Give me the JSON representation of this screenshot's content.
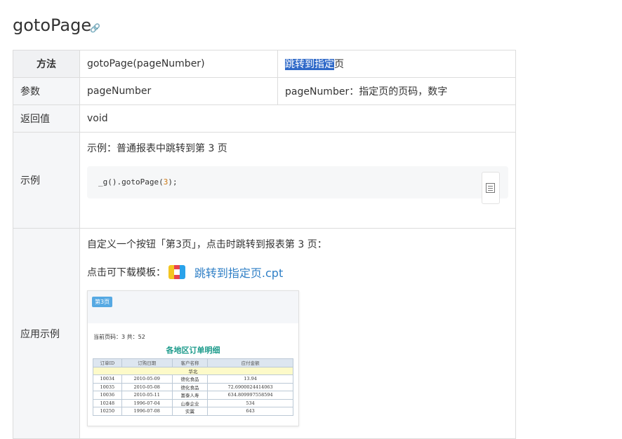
{
  "page": {
    "title": "gotoPage",
    "link_icon": "link-icon"
  },
  "table": {
    "header": {
      "label": "方法",
      "signature": "gotoPage(pageNumber)",
      "desc_selected": "跳转到指定",
      "desc_rest": "页"
    },
    "params": {
      "label": "参数",
      "name": "pageNumber",
      "desc": "pageNumber：指定页的页码，数字"
    },
    "returns": {
      "label": "返回值",
      "value": "void"
    },
    "example": {
      "label": "示例",
      "intro": "示例：普通报表中跳转到第 3 页",
      "code_prefix": "_g().gotoPage(",
      "code_arg": "3",
      "code_suffix": ");",
      "copy_icon": "copy-icon"
    },
    "usage": {
      "label": "应用示例",
      "intro": "自定义一个按钮「第3页」，点击时跳转到报表第 3 页：",
      "download_label": "点击可下载模板：",
      "file_name": "跳转到指定页.cpt",
      "file_icon": "cpt-file-icon",
      "preview": {
        "button": "第3页",
        "page_info": "当前页码：3 共：52",
        "title": "各地区订单明细",
        "columns": [
          "订单ID",
          "订购日期",
          "客户名称",
          "应付金额"
        ],
        "group": "华北",
        "rows": [
          [
            "10034",
            "2010-05-09",
            "德化食品",
            "13.94"
          ],
          [
            "10035",
            "2010-05-08",
            "德化食品",
            "72.6900024414063"
          ],
          [
            "10036",
            "2010-05-11",
            "富泰人寿",
            "634.809997558594"
          ],
          [
            "10248",
            "1996-07-04",
            "山泰企业",
            "534"
          ],
          [
            "10250",
            "1996-07-08",
            "实翼",
            "643"
          ]
        ]
      }
    }
  }
}
